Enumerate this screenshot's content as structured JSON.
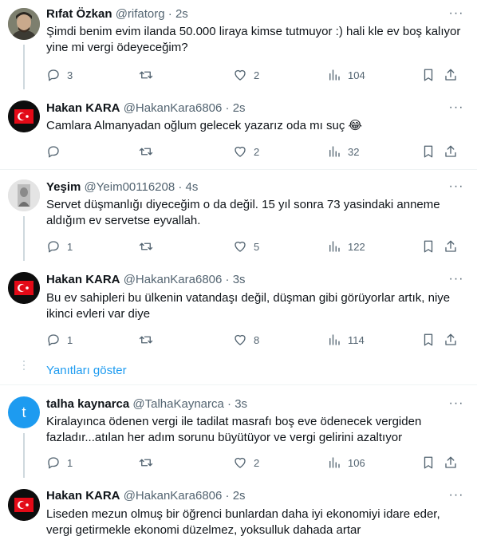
{
  "tweets": [
    {
      "name": "Rıfat Özkan",
      "handle": "@rifatorg",
      "time": "2s",
      "text": "Şimdi benim evim ilanda 50.000 liraya kimse tutmuyor :) hali kle ev boş kalıyor yine mi vergi ödeyeceğim?",
      "replies": "3",
      "retweets": "",
      "likes": "2",
      "views": "104"
    },
    {
      "name": "Hakan KARA",
      "handle": "@HakanKara6806",
      "time": "2s",
      "text": "Camlara Almanyadan oğlum gelecek yazarız oda mı suç 😂",
      "replies": "",
      "retweets": "",
      "likes": "2",
      "views": "32"
    },
    {
      "name": "Yeşim",
      "handle": "@Yeim00116208",
      "time": "4s",
      "text": "Servet düşmanlığı diyeceğim o da değil. 15 yıl sonra 73 yasindaki anneme aldığım ev servetse eyvallah.",
      "replies": "1",
      "retweets": "",
      "likes": "5",
      "views": "122"
    },
    {
      "name": "Hakan KARA",
      "handle": "@HakanKara6806",
      "time": "3s",
      "text": "Bu ev sahipleri bu ülkenin vatandaşı değil, düşman gibi görüyorlar artık, niye ikinci evleri var diye",
      "replies": "1",
      "retweets": "",
      "likes": "8",
      "views": "114"
    },
    {
      "name": "talha kaynarca",
      "handle": "@TalhaKaynarca",
      "time": "3s",
      "text": "Kiralayınca ödenen vergi ile tadilat masrafı boş eve ödenecek vergiden fazladır...atılan her adım sorunu büyütüyor ve vergi gelirini azaltıyor",
      "replies": "1",
      "retweets": "",
      "likes": "2",
      "views": "106"
    },
    {
      "name": "Hakan KARA",
      "handle": "@HakanKara6806",
      "time": "2s",
      "text": "Liseden mezun olmuş bir öğrenci bunlardan daha iyi ekonomiyi idare eder, vergi getirmekle ekonomi düzelmez, yoksulluk dahada artar",
      "replies": "",
      "retweets": "",
      "likes": "",
      "views": ""
    }
  ],
  "show_replies": "Yanıtları göster",
  "talha_avatar_letter": "t",
  "sep": " · ",
  "colors": {
    "accent": "#1d9bf0",
    "muted": "#536471",
    "text": "#0f1419",
    "border": "#eff3f4"
  }
}
